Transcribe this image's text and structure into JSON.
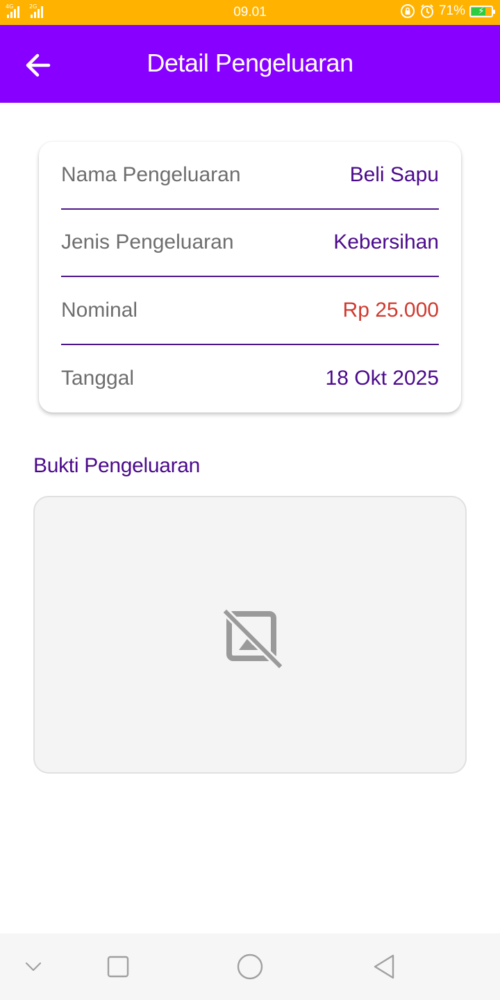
{
  "status_bar": {
    "network_1": "4G",
    "network_2": "2G",
    "time": "09.01",
    "battery_percent": "71%",
    "battery_level": 0.71,
    "icons": [
      "rotation-lock-icon",
      "alarm-icon",
      "battery-charging-icon"
    ]
  },
  "app_bar": {
    "title": "Detail Pengeluaran",
    "back_icon": "arrow-left-icon",
    "background": "#8800FF"
  },
  "details": [
    {
      "label": "Nama Pengeluaran",
      "value": "Beli Sapu"
    },
    {
      "label": "Jenis Pengeluaran",
      "value": "Kebersihan"
    },
    {
      "label": "Nominal",
      "value": "Rp 25.000"
    },
    {
      "label": "Tanggal",
      "value": "18 Okt 2025"
    }
  ],
  "proof": {
    "title": "Bukti Pengeluaran",
    "placeholder_icon": "broken-image-icon"
  },
  "colors": {
    "status_bar": "#FFB300",
    "accent": "#8800FF",
    "value_text": "#4B0A8C",
    "amount_text": "#D03A2E",
    "label_text": "#6E6E6E"
  },
  "nav_bar": {
    "buttons": [
      "chevron-down-icon",
      "square-recents-icon",
      "circle-home-icon",
      "triangle-back-icon"
    ]
  }
}
